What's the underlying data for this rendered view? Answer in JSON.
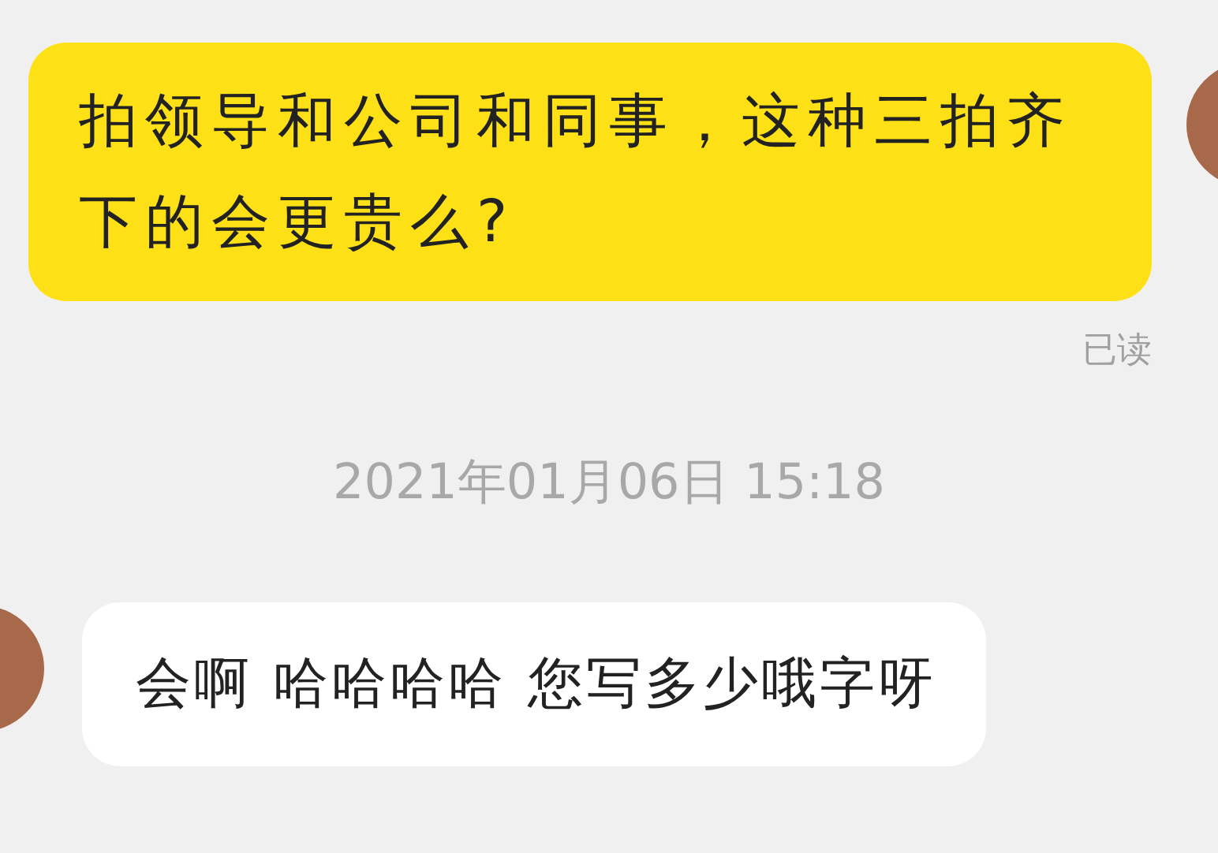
{
  "messages": [
    {
      "kind": "outgoing",
      "text": "拍领导和公司和同事，这种三拍齐下的会更贵么?",
      "receipt": "已读"
    },
    {
      "kind": "timestamp",
      "text": "2021年01月06日 15:18"
    },
    {
      "kind": "incoming",
      "text": "会啊 哈哈哈哈 您写多少哦字呀"
    }
  ]
}
